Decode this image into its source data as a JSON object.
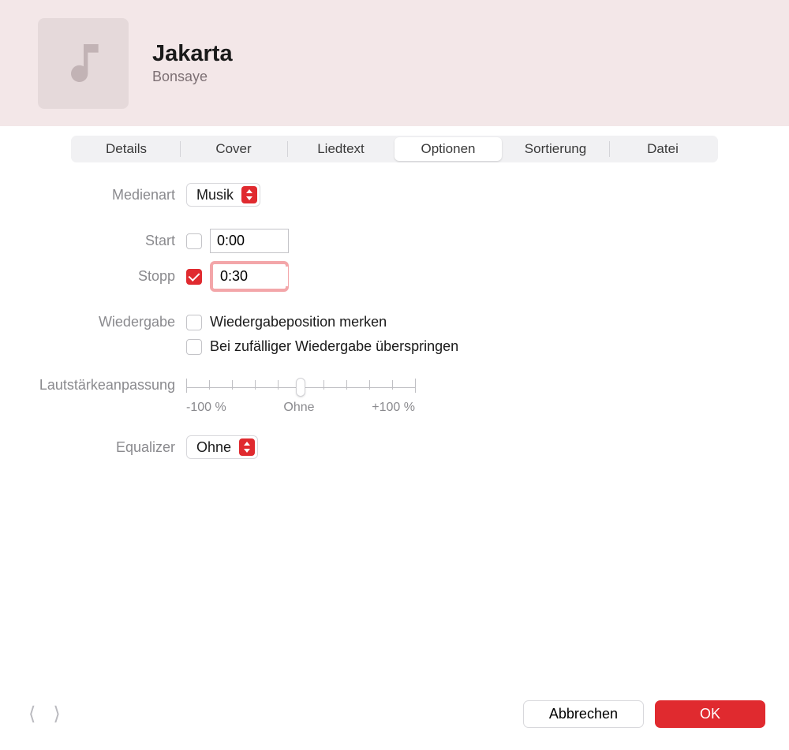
{
  "header": {
    "track_title": "Jakarta",
    "artist": "Bonsaye",
    "artwork_icon": "music-note-icon"
  },
  "tabs": [
    {
      "id": "details",
      "label": "Details",
      "active": false
    },
    {
      "id": "cover",
      "label": "Cover",
      "active": false
    },
    {
      "id": "lyrics",
      "label": "Liedtext",
      "active": false
    },
    {
      "id": "options",
      "label": "Optionen",
      "active": true
    },
    {
      "id": "sorting",
      "label": "Sortierung",
      "active": false
    },
    {
      "id": "file",
      "label": "Datei",
      "active": false
    }
  ],
  "options": {
    "media_kind": {
      "label": "Medienart",
      "value": "Musik"
    },
    "start": {
      "label": "Start",
      "enabled": false,
      "value": "0:00"
    },
    "stop": {
      "label": "Stopp",
      "enabled": true,
      "value": "0:30",
      "highlighted": true
    },
    "playback": {
      "label": "Wiedergabe",
      "remember_position": {
        "checked": false,
        "text": "Wiedergabeposition merken"
      },
      "skip_shuffle": {
        "checked": false,
        "text": "Bei zufälliger Wiedergabe überspringen"
      }
    },
    "volume": {
      "label": "Lautstärkeanpassung",
      "min_label": "-100 %",
      "mid_label": "Ohne",
      "max_label": "+100 %",
      "value_percent": 50
    },
    "equalizer": {
      "label": "Equalizer",
      "value": "Ohne"
    }
  },
  "footer": {
    "cancel_label": "Abbrechen",
    "ok_label": "OK"
  }
}
